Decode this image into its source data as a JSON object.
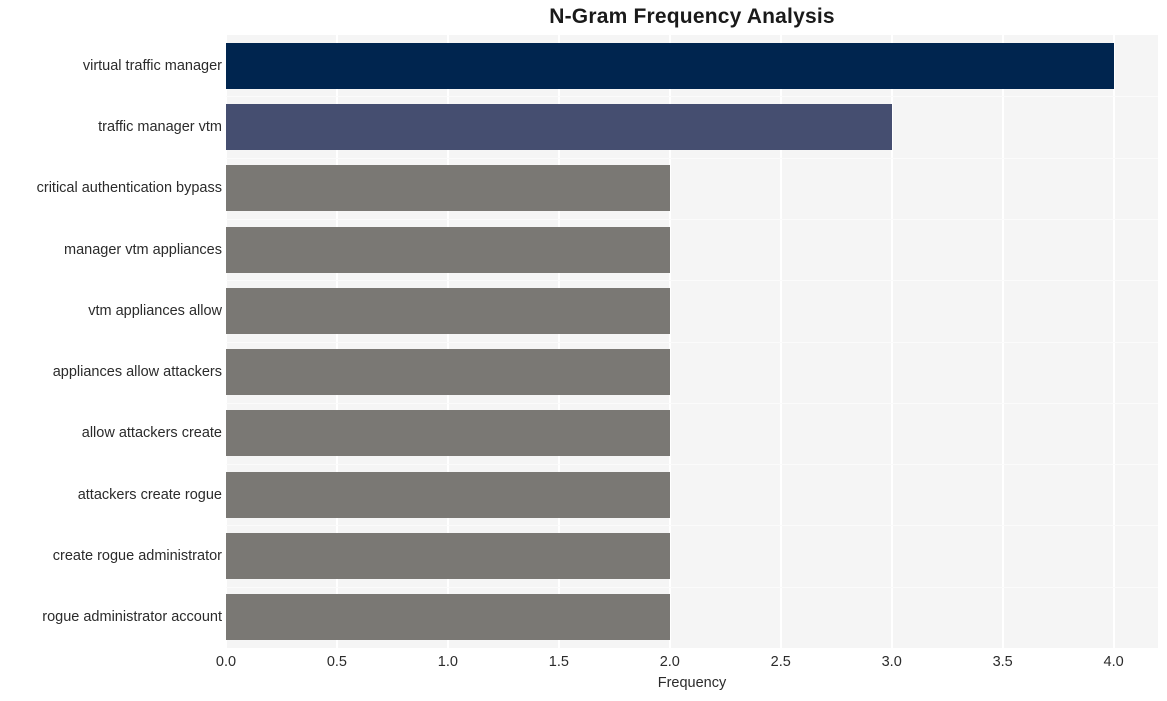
{
  "chart_data": {
    "type": "bar",
    "orientation": "horizontal",
    "title": "N-Gram Frequency Analysis",
    "xlabel": "Frequency",
    "ylabel": "",
    "xlim": [
      0,
      4.2
    ],
    "xticks": [
      "0.0",
      "0.5",
      "1.0",
      "1.5",
      "2.0",
      "2.5",
      "3.0",
      "3.5",
      "4.0"
    ],
    "xtick_values": [
      0,
      0.5,
      1,
      1.5,
      2,
      2.5,
      3,
      3.5,
      4
    ],
    "grid": true,
    "grid_axis": "x",
    "legend": "none",
    "categories": [
      "virtual traffic manager",
      "traffic manager vtm",
      "critical authentication bypass",
      "manager vtm appliances",
      "vtm appliances allow",
      "appliances allow attackers",
      "allow attackers create",
      "attackers create rogue",
      "create rogue administrator",
      "rogue administrator account"
    ],
    "values": [
      4,
      3,
      2,
      2,
      2,
      2,
      2,
      2,
      2,
      2
    ],
    "bar_colors": [
      "#00254f",
      "#454e70",
      "#7a7874",
      "#7a7874",
      "#7a7874",
      "#7a7874",
      "#7a7874",
      "#7a7874",
      "#7a7874",
      "#7a7874"
    ],
    "plot_background": "#f5f5f5",
    "grid_color": "#ffffff",
    "figure_background": "#ffffff"
  }
}
